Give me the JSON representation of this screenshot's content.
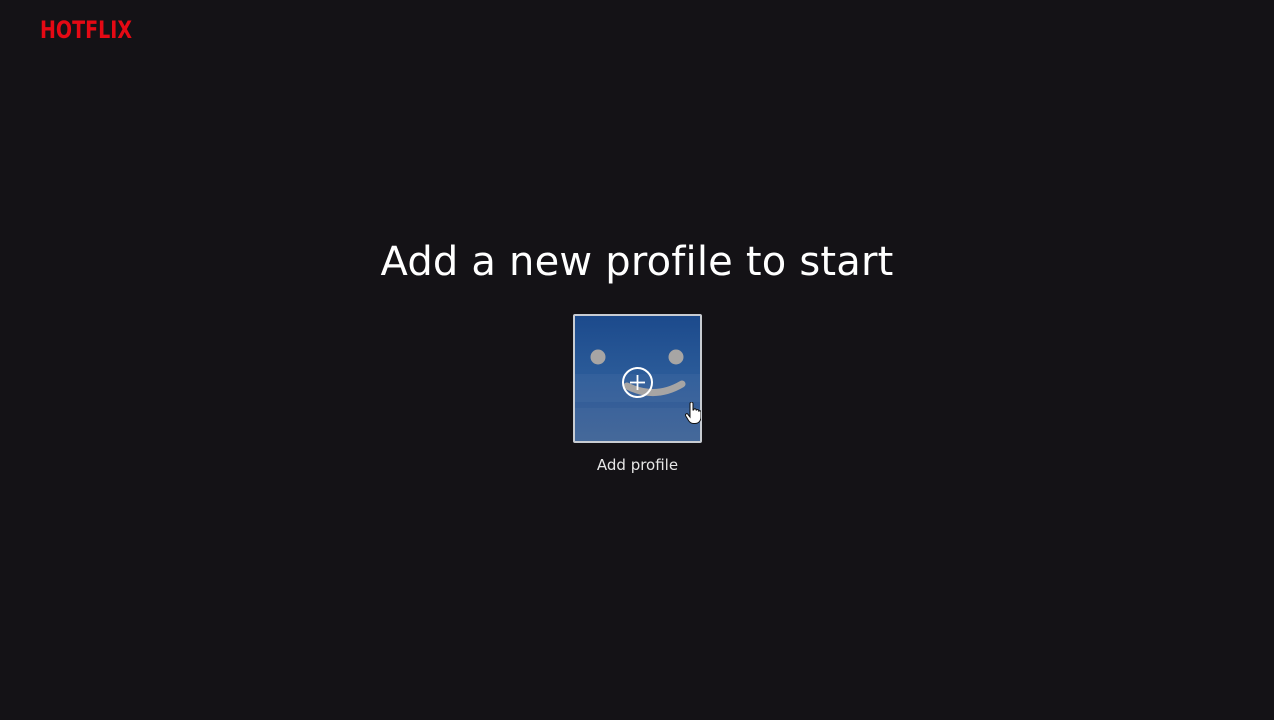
{
  "brand": {
    "logo_text": "HOTFLIX",
    "color": "#e50914"
  },
  "header": {
    "title": "Add a new profile to start"
  },
  "profiles": [
    {
      "label": "Add profile",
      "icon": "add-circle-icon",
      "avatar": "smiley-face-icon",
      "avatar_color": "#1c4a8c"
    }
  ],
  "colors": {
    "background": "#141216",
    "text": "#ffffff"
  }
}
